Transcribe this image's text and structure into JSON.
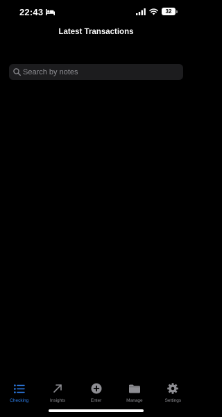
{
  "status_bar": {
    "time": "22:43",
    "battery_level": "32"
  },
  "header": {
    "title": "Latest Transactions"
  },
  "search": {
    "placeholder": "Search by notes",
    "value": ""
  },
  "tab_bar": {
    "active_color": "#2f80ed",
    "inactive_color": "#8e8e93",
    "items": [
      {
        "label": "Checking",
        "icon": "list-icon",
        "active": true
      },
      {
        "label": "Insights",
        "icon": "arrow-up-right-icon",
        "active": false
      },
      {
        "label": "Enter",
        "icon": "plus-circle-icon",
        "active": false
      },
      {
        "label": "Manage",
        "icon": "folder-icon",
        "active": false
      },
      {
        "label": "Settings",
        "icon": "gear-icon",
        "active": false
      }
    ]
  }
}
